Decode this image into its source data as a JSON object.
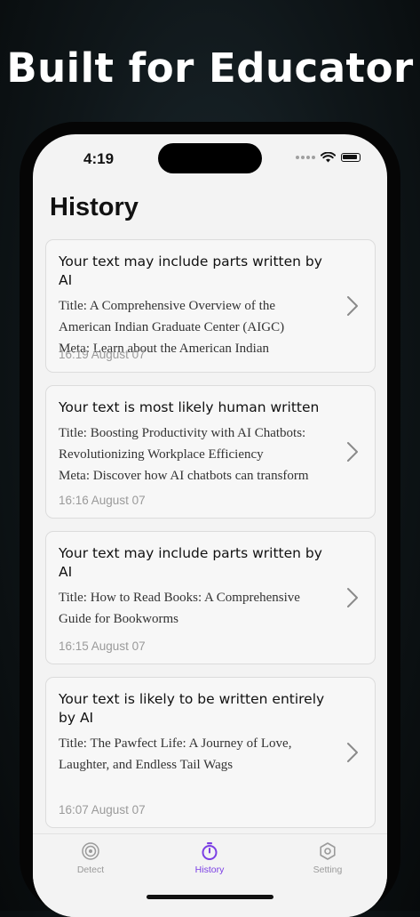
{
  "promo": {
    "headline": "Built for Educator"
  },
  "status_bar": {
    "time": "4:19"
  },
  "page": {
    "title": "History"
  },
  "history": [
    {
      "verdict": "Your text may include parts written by AI",
      "excerpt": "Title: A Comprehensive Overview of the\nAmerican Indian Graduate Center (AIGC)\nMeta: Learn about the American Indian",
      "timestamp": "16:19 August 07"
    },
    {
      "verdict": "Your text is most likely human written",
      "excerpt": "Title: Boosting Productivity with AI Chatbots:\nRevolutionizing Workplace Efficiency\nMeta: Discover how AI chatbots can transform",
      "timestamp": "16:16 August 07"
    },
    {
      "verdict": "Your text may include parts written by AI",
      "excerpt": "Title: How to Read Books: A Comprehensive\nGuide for Bookworms",
      "timestamp": "16:15 August 07"
    },
    {
      "verdict": "Your text is likely to be written entirely by AI",
      "excerpt": "Title: The Pawfect Life: A Journey of Love,\nLaughter, and Endless Tail Wags",
      "timestamp": "16:07 August 07"
    }
  ],
  "tab_bar": {
    "tabs": [
      {
        "label": "Detect",
        "icon": "radar-icon",
        "active": false
      },
      {
        "label": "History",
        "icon": "stopwatch-icon",
        "active": true
      },
      {
        "label": "Setting",
        "icon": "gear-icon",
        "active": false
      }
    ]
  },
  "colors": {
    "accent": "#7b3fe4",
    "inactive": "#9a9a9a",
    "screen_bg": "#f3f3f3"
  }
}
